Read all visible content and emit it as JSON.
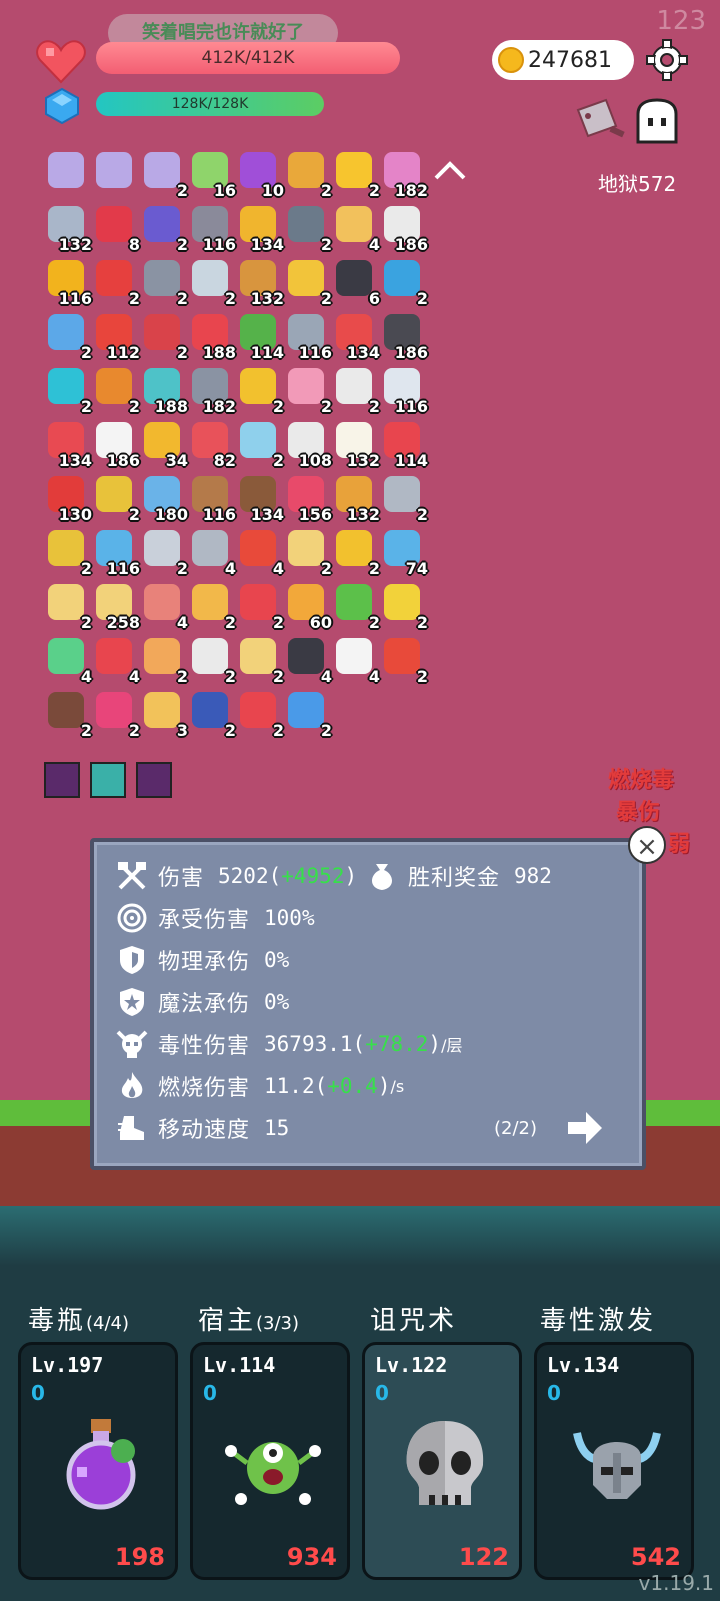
{
  "hud": {
    "corner_number": "123",
    "song_banner": "笑着唱完也许就好了",
    "hp": "412K/412K",
    "mana": "128K/128K",
    "coins": "247681",
    "hell_level": "地狱572"
  },
  "items": [
    {
      "icon": "rank-card-icon",
      "color": "#b9a9e6",
      "count": ""
    },
    {
      "icon": "rank-card-icon",
      "color": "#b9a9e6",
      "count": ""
    },
    {
      "icon": "rank-card-icon",
      "color": "#b9a9e6",
      "count": "2"
    },
    {
      "icon": "green-book-icon",
      "color": "#8fd46b",
      "count": "16"
    },
    {
      "icon": "potion-icon",
      "color": "#a04fd8",
      "count": "10"
    },
    {
      "icon": "pineapple-icon",
      "color": "#e9a83a",
      "count": "2"
    },
    {
      "icon": "sun-icon",
      "color": "#f7c52e",
      "count": "2"
    },
    {
      "icon": "flower-icon",
      "color": "#e484c8",
      "count": "182"
    },
    {
      "icon": "sword-icon",
      "color": "#a9b6c9",
      "count": "132"
    },
    {
      "icon": "ruby-icon",
      "color": "#e23a4a",
      "count": "8"
    },
    {
      "icon": "wizard-hat-icon",
      "color": "#6a5bd0",
      "count": "2"
    },
    {
      "icon": "door-icon",
      "color": "#8a8a9a",
      "count": "116"
    },
    {
      "icon": "coin-stack-icon",
      "color": "#f0b52e",
      "count": "134"
    },
    {
      "icon": "mortar-icon",
      "color": "#6b7a8a",
      "count": "2"
    },
    {
      "icon": "scroll-icon",
      "color": "#f2c15c",
      "count": "4"
    },
    {
      "icon": "flag-icon",
      "color": "#eaeaea",
      "count": "186"
    },
    {
      "icon": "sunflower-icon",
      "color": "#f2b31d",
      "count": "116"
    },
    {
      "icon": "mushroom-icon",
      "color": "#e6403e",
      "count": "2"
    },
    {
      "icon": "spike-ball-icon",
      "color": "#8a93a3",
      "count": "2"
    },
    {
      "icon": "molecule-icon",
      "color": "#c9d6e0",
      "count": "2"
    },
    {
      "icon": "brown-book-icon",
      "color": "#d8953e",
      "count": "132"
    },
    {
      "icon": "beer-icon",
      "color": "#f2c43a",
      "count": "2"
    },
    {
      "icon": "cauldron-icon",
      "color": "#3a3a44",
      "count": "6"
    },
    {
      "icon": "star-card-icon",
      "color": "#3aa3e0",
      "count": "2"
    },
    {
      "icon": "shirt-icon",
      "color": "#5ca8e8",
      "count": "2"
    },
    {
      "icon": "tomato-icon",
      "color": "#e8453c",
      "count": "112"
    },
    {
      "icon": "shield-icon",
      "color": "#d9434a",
      "count": "2"
    },
    {
      "icon": "heart-icon",
      "color": "#e8454e",
      "count": "188"
    },
    {
      "icon": "money-icon",
      "color": "#55b24a",
      "count": "114"
    },
    {
      "icon": "axe-icon",
      "color": "#9aa6b6",
      "count": "116"
    },
    {
      "icon": "sock-icon",
      "color": "#e84b4b",
      "count": "134"
    },
    {
      "icon": "robot-icon",
      "color": "#4a4a52",
      "count": "186"
    },
    {
      "icon": "target-icon",
      "color": "#2ec1d6",
      "count": "2"
    },
    {
      "icon": "bag-icon",
      "color": "#e8892e",
      "count": "2"
    },
    {
      "icon": "tire-icon",
      "color": "#4ec2c8",
      "count": "188"
    },
    {
      "icon": "mace-icon",
      "color": "#8a93a3",
      "count": "182"
    },
    {
      "icon": "crown-icon",
      "color": "#f2c12e",
      "count": "2"
    },
    {
      "icon": "ice-cream-icon",
      "color": "#f29ab8",
      "count": "2"
    },
    {
      "icon": "cards-icon",
      "color": "#eaeaea",
      "count": "2"
    },
    {
      "icon": "mail-icon",
      "color": "#dfe6ee",
      "count": "116"
    },
    {
      "icon": "watermelon-icon",
      "color": "#e84a52",
      "count": "134"
    },
    {
      "icon": "skull-icon",
      "color": "#f4f4f4",
      "count": "186"
    },
    {
      "icon": "rainbow-icon",
      "color": "#f2b82e",
      "count": "34"
    },
    {
      "icon": "pill-icon",
      "color": "#e8525a",
      "count": "82"
    },
    {
      "icon": "blue-tile-icon",
      "color": "#8fd0ec",
      "count": "2"
    },
    {
      "icon": "dice-icon",
      "color": "#eaeaea",
      "count": "108"
    },
    {
      "icon": "egg-icon",
      "color": "#f8f4e8",
      "count": "132"
    },
    {
      "icon": "spray-icon",
      "color": "#e8454e",
      "count": "114"
    },
    {
      "icon": "apple-icon",
      "color": "#e23c3a",
      "count": "130"
    },
    {
      "icon": "nodes-icon",
      "color": "#e8c23a",
      "count": "2"
    },
    {
      "icon": "blue-potion-icon",
      "color": "#6ab3e8",
      "count": "180"
    },
    {
      "icon": "coconut-icon",
      "color": "#b47a4a",
      "count": "116"
    },
    {
      "icon": "donut-icon",
      "color": "#8a5a3a",
      "count": "134"
    },
    {
      "icon": "jam-jar-icon",
      "color": "#e84a6a",
      "count": "156"
    },
    {
      "icon": "meteor-icon",
      "color": "#e8a23a",
      "count": "132"
    },
    {
      "icon": "compass-icon",
      "color": "#b0b8c4",
      "count": "2"
    },
    {
      "icon": "durian-icon",
      "color": "#e8c23a",
      "count": "2"
    },
    {
      "icon": "syringe-icon",
      "color": "#5ab3e8",
      "count": "116"
    },
    {
      "icon": "hook-icon",
      "color": "#c9d0da",
      "count": "2"
    },
    {
      "icon": "crossed-swords-icon",
      "color": "#b0b8c4",
      "count": "4"
    },
    {
      "icon": "map-pin-icon",
      "color": "#e84a3a",
      "count": "4"
    },
    {
      "icon": "parchment-icon",
      "color": "#f2d27a",
      "count": "2"
    },
    {
      "icon": "ring-icon",
      "color": "#f2c12e",
      "count": "2"
    },
    {
      "icon": "capsule-icon",
      "color": "#5ab3e8",
      "count": "74"
    },
    {
      "icon": "note-icon",
      "color": "#f2d27a",
      "count": "2"
    },
    {
      "icon": "map-icon",
      "color": "#f2d27a",
      "count": "258"
    },
    {
      "icon": "meat-icon",
      "color": "#e8827a",
      "count": "4"
    },
    {
      "icon": "menu-icon",
      "color": "#f2b84a",
      "count": "2"
    },
    {
      "icon": "magnet-icon",
      "color": "#e8454e",
      "count": "2"
    },
    {
      "icon": "bread-icon",
      "color": "#f2a83a",
      "count": "60"
    },
    {
      "icon": "lime-icon",
      "color": "#5cc04a",
      "count": "2"
    },
    {
      "icon": "magic-wand-icon",
      "color": "#f2d23a",
      "count": "2"
    },
    {
      "icon": "green-figure-icon",
      "color": "#5ad08a",
      "count": "4"
    },
    {
      "icon": "bookmark-icon",
      "color": "#e8454e",
      "count": "4"
    },
    {
      "icon": "queen-crown-icon",
      "color": "#f2a85a",
      "count": "2"
    },
    {
      "icon": "checklist-icon",
      "color": "#eaeaea",
      "count": "2"
    },
    {
      "icon": "treasure-map-icon",
      "color": "#f2d27a",
      "count": "2"
    },
    {
      "icon": "bat-icon",
      "color": "#3a3a44",
      "count": "4"
    },
    {
      "icon": "chat-bubble-icon",
      "color": "#f4f4f4",
      "count": "4"
    },
    {
      "icon": "heat-waves-icon",
      "color": "#e84a3a",
      "count": "2"
    },
    {
      "icon": "brown-mushroom-icon",
      "color": "#7a4a3a",
      "count": "2"
    },
    {
      "icon": "pink-drop-icon",
      "color": "#e8457a",
      "count": "2"
    },
    {
      "icon": "world-map-icon",
      "color": "#f2c25a",
      "count": "3"
    },
    {
      "icon": "bible-icon",
      "color": "#3a5ab8",
      "count": "2"
    },
    {
      "icon": "gear-skull-icon",
      "color": "#e8454e",
      "count": "2"
    },
    {
      "icon": "snowflake-icon",
      "color": "#4a9ae8",
      "count": "2"
    }
  ],
  "equipment_slots": [
    {
      "icon": "demon-mask-icon",
      "color": "#5a2a6a"
    },
    {
      "icon": "glow-gem-icon",
      "color": "#3ab0a8"
    },
    {
      "icon": "demon-mask-icon",
      "color": "#5a2a6a"
    }
  ],
  "float_texts": [
    "燃烧毒",
    "暴伤",
    "弱"
  ],
  "stats": {
    "damage_label": "伤害",
    "damage_value": "5202",
    "damage_bonus": "+4952",
    "reward_label": "胜利奖金",
    "reward_value": "982",
    "taken_label": "承受伤害",
    "taken_value": "100%",
    "phys_label": "物理承伤",
    "phys_value": "0%",
    "magic_label": "魔法承伤",
    "magic_value": "0%",
    "poison_label": "毒性伤害",
    "poison_value": "36793.1",
    "poison_bonus": "+78.2",
    "poison_unit": "/层",
    "burn_label": "燃烧伤害",
    "burn_value": "11.2",
    "burn_bonus": "+0.4",
    "burn_unit": "/s",
    "speed_label": "移动速度",
    "speed_value": "15",
    "page": "(2/2)",
    "close": "×"
  },
  "skills": [
    {
      "title": "毒瓶",
      "sub": "(4/4)",
      "level": "Lv.197",
      "cost": "0",
      "number": "198",
      "icon": "poison-bottle-icon",
      "active": false
    },
    {
      "title": "宿主",
      "sub": "(3/3)",
      "level": "Lv.114",
      "cost": "0",
      "number": "934",
      "icon": "monster-icon",
      "active": false
    },
    {
      "title": "诅咒术",
      "sub": "",
      "level": "Lv.122",
      "cost": "0",
      "number": "122",
      "icon": "skull-icon",
      "active": true
    },
    {
      "title": "毒性激发",
      "sub": "",
      "level": "Lv.134",
      "cost": "0",
      "number": "542",
      "icon": "horned-helmet-icon",
      "active": false
    }
  ],
  "version": "v1.19.1"
}
